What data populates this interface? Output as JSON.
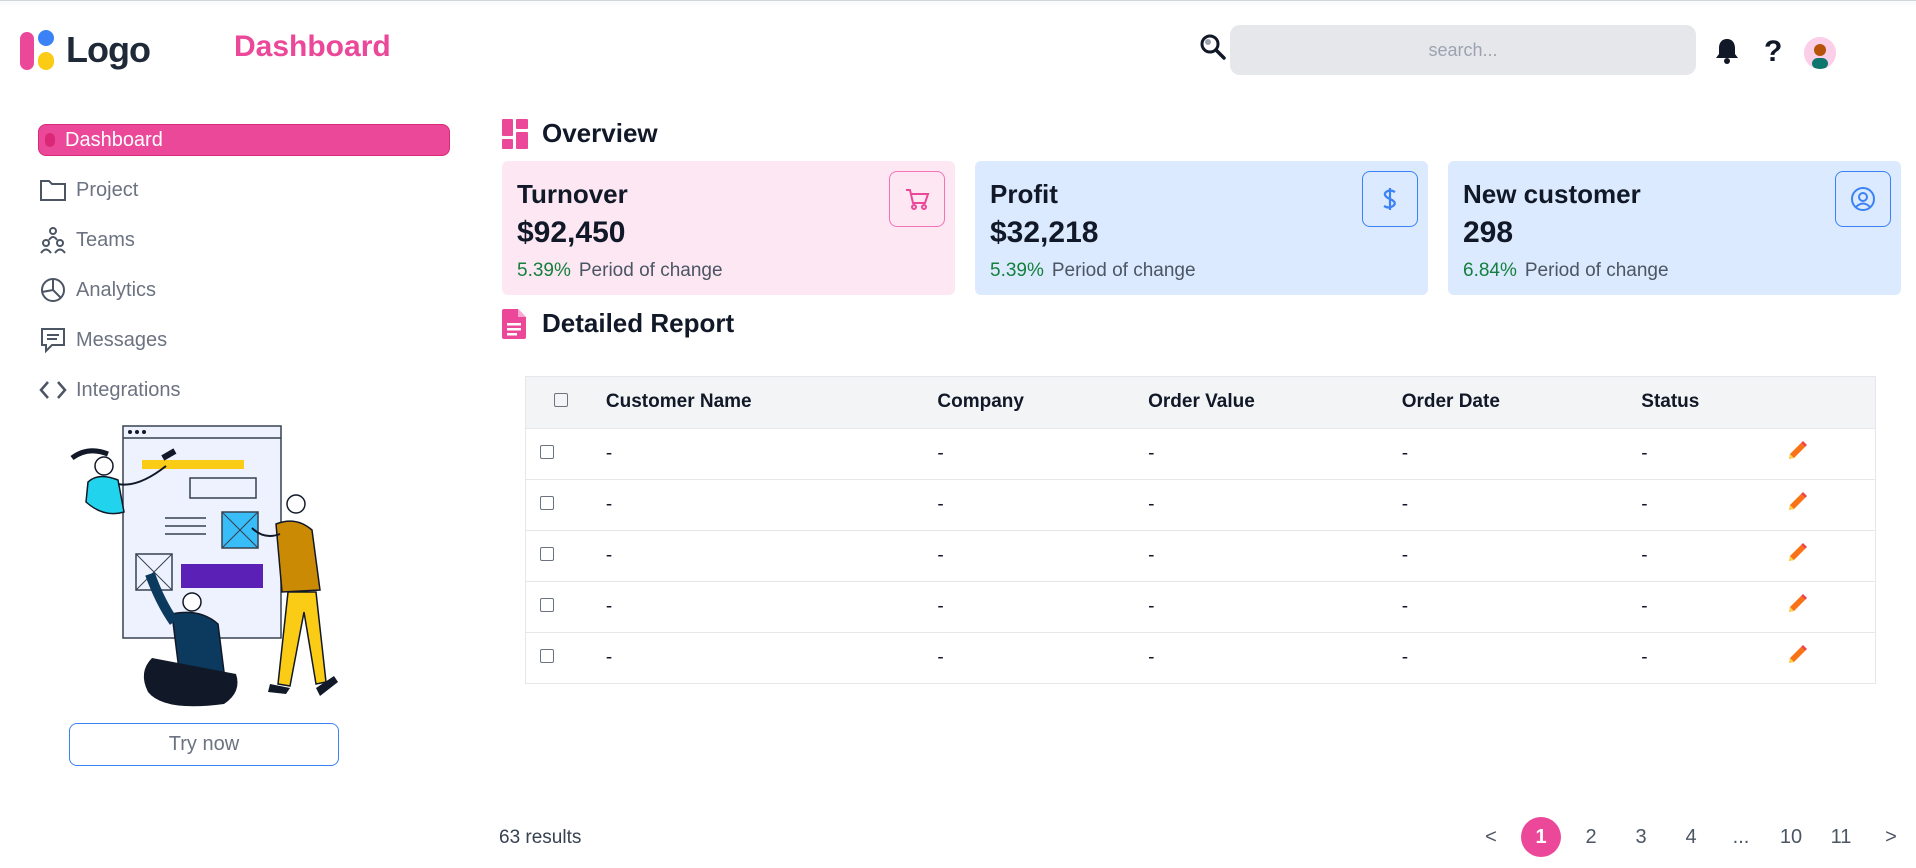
{
  "header": {
    "logo_text": "Logo",
    "page_title": "Dashboard",
    "search_placeholder": "search...",
    "help_label": "?"
  },
  "sidebar": {
    "items": [
      {
        "label": "Dashboard",
        "icon": "dot-icon",
        "active": true
      },
      {
        "label": "Project",
        "icon": "folder-icon"
      },
      {
        "label": "Teams",
        "icon": "teams-icon"
      },
      {
        "label": "Analytics",
        "icon": "pie-chart-icon"
      },
      {
        "label": "Messages",
        "icon": "message-icon"
      },
      {
        "label": "Integrations",
        "icon": "code-icon"
      }
    ],
    "try_label": "Try now"
  },
  "overview": {
    "title": "Overview",
    "cards": [
      {
        "title": "Turnover",
        "value": "$92,450",
        "pct": "5.39%",
        "change_label": "Period of change",
        "icon": "cart-icon",
        "color": "#fce7f3"
      },
      {
        "title": "Profit",
        "value": "$32,218",
        "pct": "5.39%",
        "change_label": "Period of change",
        "icon": "dollar-icon",
        "color": "#dbeafe"
      },
      {
        "title": "New customer",
        "value": "298",
        "pct": "6.84%",
        "change_label": "Period of change",
        "icon": "user-circle-icon",
        "color": "#dbeafe"
      }
    ]
  },
  "report": {
    "title": "Detailed Report",
    "columns": [
      "Customer Name",
      "Company",
      "Order Value",
      "Order Date",
      "Status"
    ],
    "rows": [
      [
        "-",
        "-",
        "-",
        "-",
        "-"
      ],
      [
        "-",
        "-",
        "-",
        "-",
        "-"
      ],
      [
        "-",
        "-",
        "-",
        "-",
        "-"
      ],
      [
        "-",
        "-",
        "-",
        "-",
        "-"
      ],
      [
        "-",
        "-",
        "-",
        "-",
        "-"
      ]
    ]
  },
  "pagination": {
    "results": "63 results",
    "prev": "<",
    "next": ">",
    "pages": [
      "1",
      "2",
      "3",
      "4",
      "...",
      "10",
      "11"
    ],
    "current": "1"
  },
  "colors": {
    "accent": "#ec4899",
    "blue": "#3b82f6",
    "positive": "#15803d"
  }
}
